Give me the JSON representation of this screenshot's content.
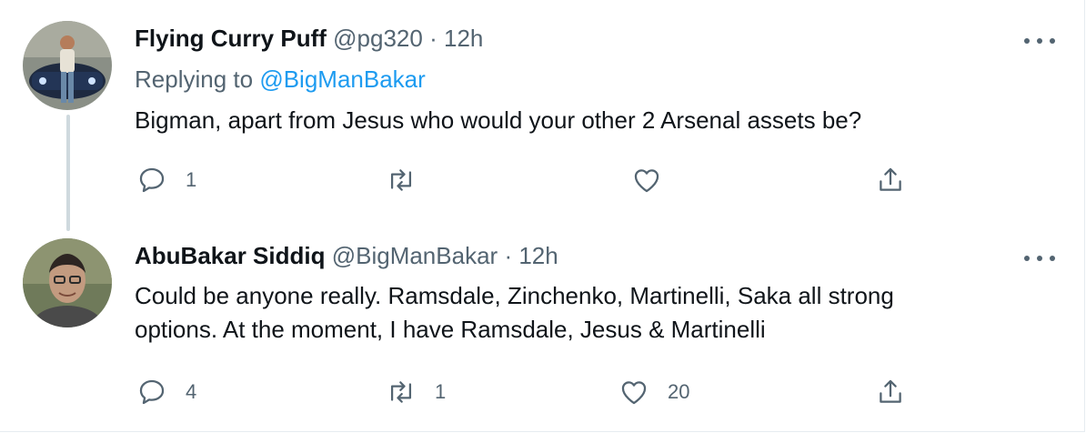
{
  "tweets": [
    {
      "display_name": "Flying Curry Puff",
      "handle": "@pg320",
      "separator": "·",
      "time": "12h",
      "reply_prefix": "Replying to",
      "reply_handle": "@BigManBakar",
      "text": "Bigman, apart from Jesus who would your other 2 Arsenal assets be?",
      "actions": {
        "replies": "1",
        "retweets": "",
        "likes": ""
      }
    },
    {
      "display_name": "AbuBakar Siddiq",
      "handle": "@BigManBakar",
      "separator": "·",
      "time": "12h",
      "text_line1": "Could be anyone really. Ramsdale, Zinchenko, Martinelli, Saka all strong",
      "text_line2": "options. At the moment, I have Ramsdale, Jesus & Martinelli",
      "actions": {
        "replies": "4",
        "retweets": "1",
        "likes": "20"
      }
    }
  ],
  "icons": {
    "reply": "reply-icon",
    "retweet": "retweet-icon",
    "like": "heart-icon",
    "share": "share-icon",
    "more": "more-icon"
  },
  "colors": {
    "text": "#0f1419",
    "muted": "#536471",
    "link": "#1d9bf0",
    "thread_line": "#cfd9de"
  }
}
